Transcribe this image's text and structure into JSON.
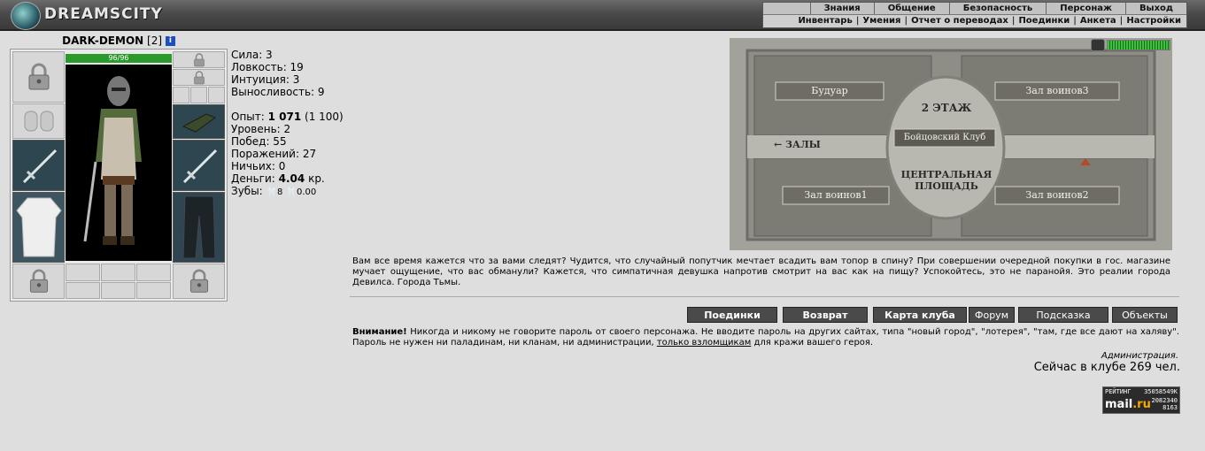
{
  "header": {
    "logo": "DREAMSCITY",
    "menu_top": [
      "Знания",
      "Общение",
      "Безопасность",
      "Персонаж",
      "Выход"
    ],
    "menu_sub": [
      "Инвентарь",
      "Умения",
      "Отчет о переводах",
      "Поединки",
      "Анкета",
      "Настройки"
    ],
    "menu_sub_sep": "|"
  },
  "character": {
    "name": "DARK-DEMON",
    "level_tag": "[2]",
    "hp_text": "96/96",
    "hp_fraction": 1.0
  },
  "stats": {
    "strength": "Сила: 3",
    "agility": "Ловкость: 19",
    "intuition": "Интуиция: 3",
    "endurance": "Выносливость: 9",
    "exp_label": "Опыт: ",
    "exp_value": "1 071",
    "exp_next": " (1 100)",
    "level": "Уровень: 2",
    "wins": "Побед: 55",
    "losses": "Поражений: 27",
    "draws": "Ничьих: 0",
    "money_label": "Деньги: ",
    "money_value": "4.04",
    "money_unit": " кр.",
    "teeth_label": "Зубы: ",
    "teeth_value": "8 ",
    "teeth_value2": "0.00"
  },
  "map": {
    "floor_label": "2 ЭТАЖ",
    "rooms": [
      "Будуар",
      "Зал воинов3",
      "Бойцовский Клуб",
      "Зал воинов1",
      "Зал воинов2"
    ],
    "exit_label": "← ЗАЛЫ",
    "square_line1": "ЦЕНТРАЛЬНАЯ",
    "square_line2": "ПЛОЩАДЬ"
  },
  "flavor_text": "Вам все время кажется что за вами следят? Чудится, что случайный попутчик мечтает всадить вам топор в спину? При совершении очередной покупки в гос. магазине мучает ощущение, что вас обманули? Кажется, что симпатичная девушка напротив смотрит на вас как на пищу? Успокойтесь, это не паранойя. Это реалии города Девилса. Города Тьмы.",
  "buttons": [
    "Поединки",
    "Возврат",
    "Карта клуба",
    "Форум",
    "Подсказка",
    "Объекты"
  ],
  "warning": {
    "title": "Внимание!",
    "text": " Никогда и никому не говорите пароль от своего персонажа. Не вводите пароль на других сайтах, типа \"новый город\", \"лотерея\", \"там, где все дают на халяву\". Пароль не нужен ни паладинам, ни кланам, ни администрации, ",
    "link": "только взломщикам",
    "tail": " для кражи вашего героя.",
    "signature": "Администрация."
  },
  "online": "Сейчас в клубе 269 чел.",
  "counter": {
    "label": "РЕЙТИНГ",
    "id": "35058549K",
    "brand_a": "mail",
    "brand_b": ".ru",
    "num1": "2082340",
    "num2": "8163"
  }
}
